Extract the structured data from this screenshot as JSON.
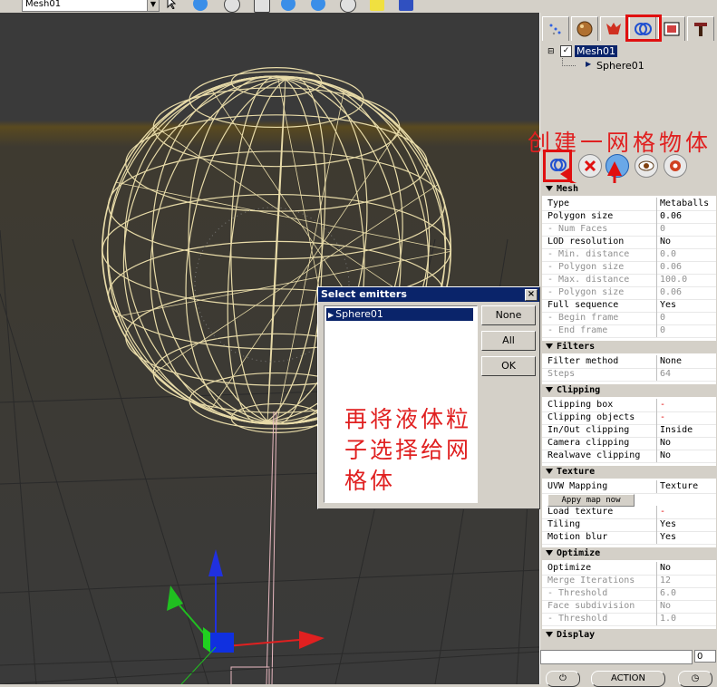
{
  "toolbar": {
    "object_selector_value": "Mesh01",
    "icons": [
      "pointer-icon",
      "add-icon",
      "circle-icon",
      "shape-icon",
      "x-icon",
      "up-icon",
      "z-icon",
      "note-icon",
      "save-icon"
    ]
  },
  "panel": {
    "tabs": [
      "particles-tab",
      "emitter-tab",
      "daemon-tab",
      "mesh-tab",
      "texture-tab",
      "tools-tab"
    ],
    "tree": {
      "root": "Mesh01",
      "child": "Sphere01"
    },
    "annotation_top": "创建一网格物体",
    "mesh_tools": [
      "mesh-add-icon",
      "mesh-delete-icon",
      "mesh-preview-icon",
      "mesh-eye-icon",
      "mesh-settings-icon"
    ],
    "sections": {
      "mesh": {
        "title": "Mesh",
        "rows": [
          {
            "k": "Type",
            "v": "Metaballs",
            "dim": false
          },
          {
            "k": "Polygon size",
            "v": "0.06",
            "dim": false
          },
          {
            "k": "- Num Faces",
            "v": "0",
            "dim": true
          },
          {
            "k": "LOD resolution",
            "v": "No",
            "dim": false
          },
          {
            "k": "- Min. distance",
            "v": "0.0",
            "dim": true
          },
          {
            "k": "- Polygon size",
            "v": "0.06",
            "dim": true
          },
          {
            "k": "- Max. distance",
            "v": "100.0",
            "dim": true
          },
          {
            "k": "- Polygon size",
            "v": "0.06",
            "dim": true
          },
          {
            "k": "Full sequence",
            "v": "Yes",
            "dim": false
          },
          {
            "k": "- Begin frame",
            "v": "0",
            "dim": true
          },
          {
            "k": "- End frame",
            "v": "0",
            "dim": true
          }
        ]
      },
      "filters": {
        "title": "Filters",
        "rows": [
          {
            "k": "Filter method",
            "v": "None",
            "dim": false
          },
          {
            "k": "Steps",
            "v": "64",
            "dim": true
          }
        ]
      },
      "clipping": {
        "title": "Clipping",
        "rows": [
          {
            "k": "Clipping box",
            "v": "-",
            "dim": false,
            "red": true
          },
          {
            "k": "Clipping objects",
            "v": "-",
            "dim": false,
            "red": true
          },
          {
            "k": "In/Out clipping",
            "v": "Inside",
            "dim": false
          },
          {
            "k": "Camera clipping",
            "v": "No",
            "dim": false
          },
          {
            "k": "Realwave clipping",
            "v": "No",
            "dim": false
          }
        ]
      },
      "texture": {
        "title": "Texture",
        "rows": [
          {
            "k": "UVW Mapping",
            "v": "Texture",
            "dim": false
          }
        ],
        "apply_button": "Appy map now",
        "rows2": [
          {
            "k": "Load texture",
            "v": "-",
            "dim": false,
            "red": true
          },
          {
            "k": "Tiling",
            "v": "Yes",
            "dim": false
          },
          {
            "k": "Motion blur",
            "v": "Yes",
            "dim": false
          }
        ]
      },
      "optimize": {
        "title": "Optimize",
        "rows": [
          {
            "k": "Optimize",
            "v": "No",
            "dim": false
          },
          {
            "k": "Merge Iterations",
            "v": "12",
            "dim": true
          },
          {
            "k": "- Threshold",
            "v": "6.0",
            "dim": true
          },
          {
            "k": "Face subdivision",
            "v": "No",
            "dim": true
          },
          {
            "k": "- Threshold",
            "v": "1.0",
            "dim": true
          }
        ]
      },
      "display": {
        "title": "Display"
      }
    },
    "bottom_value": "0",
    "action_label": "ACTION"
  },
  "dialog": {
    "title": "Select emitters",
    "close_label": "×",
    "list_items": [
      "Sphere01"
    ],
    "buttons": {
      "none": "None",
      "all": "All",
      "ok": "OK"
    },
    "annotation": "再将液体粒子选择给网格体"
  },
  "colors": {
    "accent_red": "#e01010",
    "wire": "#e8dba8",
    "selection": "#0a246a"
  }
}
